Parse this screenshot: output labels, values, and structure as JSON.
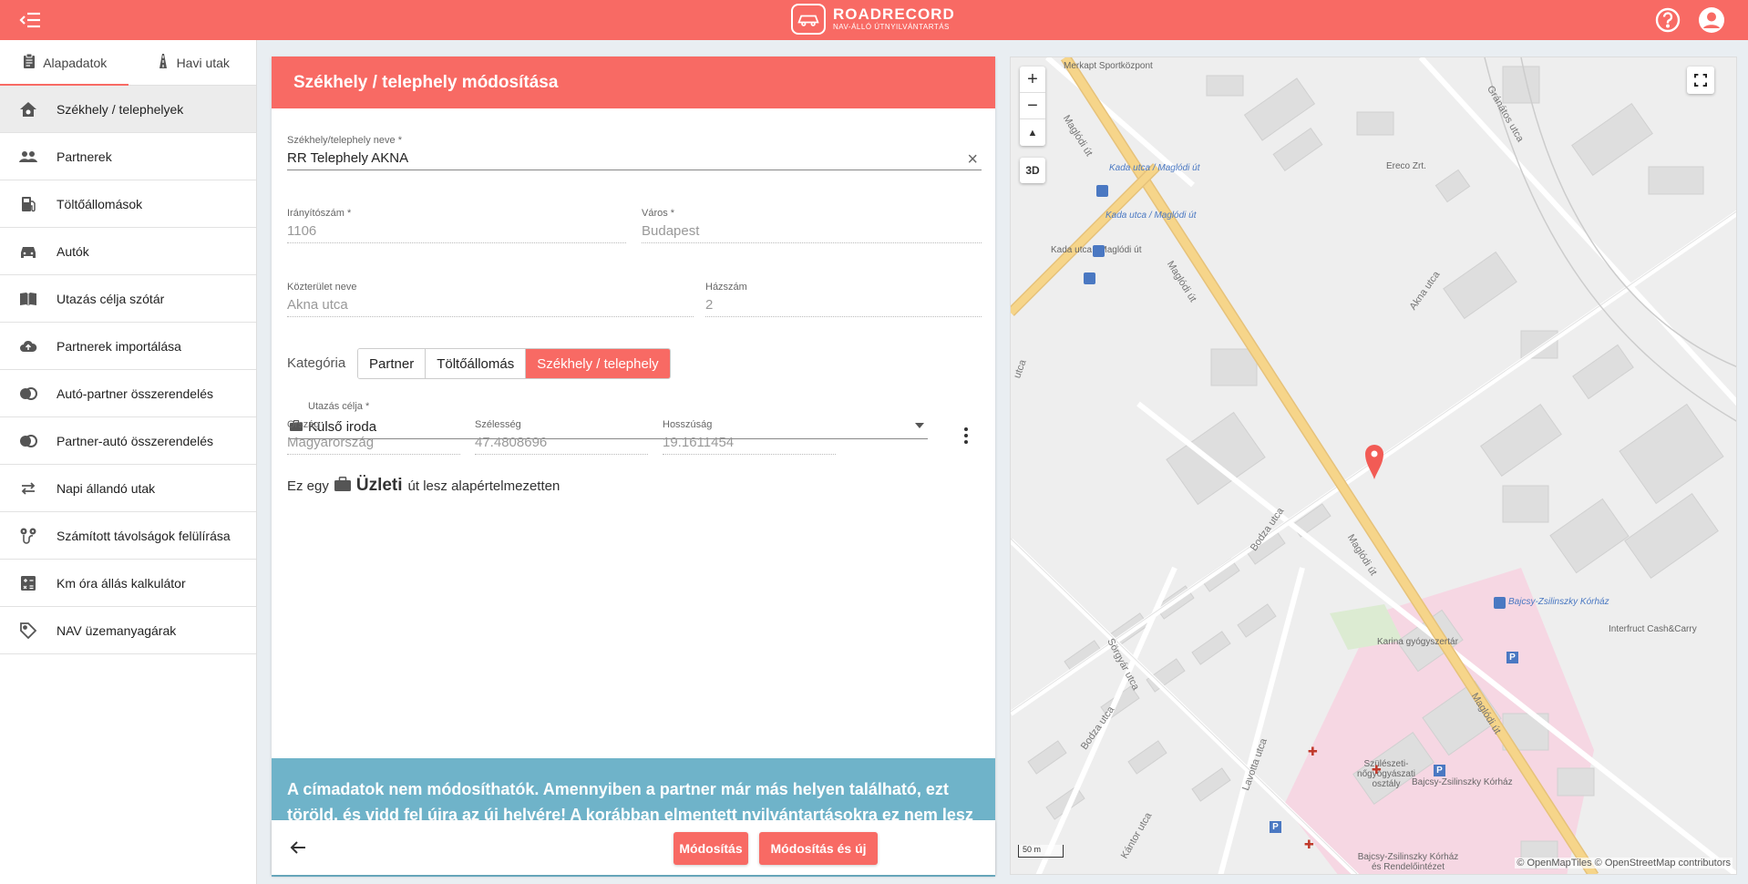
{
  "app": {
    "brand": "ROADRECORD",
    "tagline": "NAV-ÁLLÓ ÚTNYILVÁNTARTÁS"
  },
  "sidebar": {
    "tabs": [
      {
        "label": "Alapadatok",
        "active": true
      },
      {
        "label": "Havi utak",
        "active": false
      }
    ],
    "items": [
      {
        "label": "Székhely / telephelyek",
        "icon": "home-gear-icon",
        "active": true
      },
      {
        "label": "Partnerek",
        "icon": "people-icon"
      },
      {
        "label": "Töltőállomások",
        "icon": "fuel-pump-icon"
      },
      {
        "label": "Autók",
        "icon": "car-icon"
      },
      {
        "label": "Utazás célja szótár",
        "icon": "book-icon"
      },
      {
        "label": "Partnerek importálása",
        "icon": "cloud-upload-icon"
      },
      {
        "label": "Autó-partner összerendelés",
        "icon": "link-icon"
      },
      {
        "label": "Partner-autó összerendelés",
        "icon": "link-icon"
      },
      {
        "label": "Napi állandó utak",
        "icon": "repeat-icon"
      },
      {
        "label": "Számított távolságok felülírása",
        "icon": "route-icon"
      },
      {
        "label": "Km óra állás kalkulátor",
        "icon": "calculator-icon"
      },
      {
        "label": "NAV üzemanyagárak",
        "icon": "tag-icon"
      }
    ]
  },
  "form": {
    "title": "Székhely / telephely módosítása",
    "name_label": "Székhely/telephely neve *",
    "name_value": "RR Telephely AKNA",
    "zip_label": "Irányítószám *",
    "zip_value": "1106",
    "city_label": "Város *",
    "city_value": "Budapest",
    "street_label": "Közterület neve",
    "street_value": "Akna utca",
    "number_label": "Házszám",
    "number_value": "2",
    "category_label": "Kategória",
    "categories": [
      {
        "label": "Partner",
        "active": false
      },
      {
        "label": "Töltőállomás",
        "active": false
      },
      {
        "label": "Székhely / telephely",
        "active": true
      }
    ],
    "purpose_label": "Utazás célja *",
    "purpose_value": "Külső iroda",
    "info_prefix": "Ez egy",
    "info_type": "Üzleti",
    "info_suffix": "út lesz alapértelmezetten",
    "country_label": "Ország",
    "country_value": "Magyarország",
    "lat_label": "Szélesség",
    "lat_value": "47.4808696",
    "lng_label": "Hosszúság",
    "lng_value": "19.1611454",
    "notice": "A címadatok nem módosíthatók. Amennyiben a partner már más helyen található, ezt töröld, és vidd fel újra az új helyére! A korábban elmentett nyilvántartásokra ez nem lesz hatással, ott az eddigi adatokkal marad továbbra is.",
    "modify_label": "Módosítás",
    "modify_new_label": "Módosítás és új"
  },
  "map": {
    "zoom_in": "+",
    "zoom_out": "−",
    "compass": "▲",
    "three_d": "3D",
    "scale": "50 m",
    "attribution": "© OpenMapTiles © OpenStreetMap contributors",
    "labels": [
      "Merkapt Sportközpont",
      "Kada utca / Maglódi út",
      "Kada utca / Maglódi út",
      "Kada utca / Maglódi út",
      "Ereco Zrt.",
      "Maglódi út",
      "Maglódi út",
      "Maglódi út",
      "Maglódi út",
      "Akna utca",
      "Bodza utca",
      "Bodza utca",
      "Sörgyár utca",
      "Lavotta utca",
      "Gránátos utca",
      "Bajcsy-Zsilinszky Kórház",
      "Karina gyógyszertár",
      "Interfruct Cash&Carry",
      "Szülészeti-nőgyógyászati osztály",
      "Bajcsy-Zsilinszky Kórház",
      "Bajcsy-Zsilinszky Kórház és Rendelőintézet",
      "Kántor utca",
      "utca"
    ]
  },
  "colors": {
    "accent": "#f86a64",
    "notice": "#6fb3c9",
    "road": "#f6d58a"
  }
}
